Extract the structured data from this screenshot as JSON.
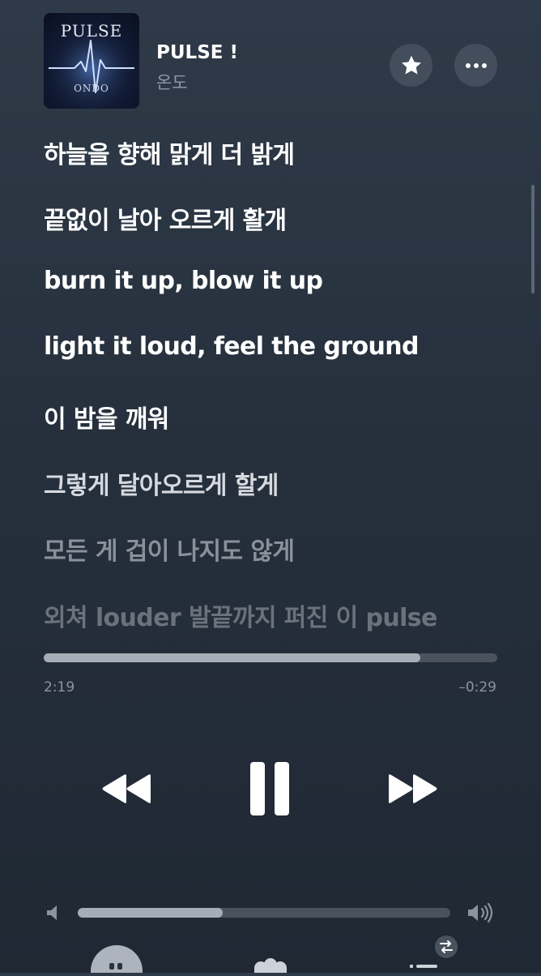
{
  "now_playing": {
    "artwork": {
      "title_text": "PULSE",
      "subtitle_text": "ONDO"
    },
    "title": "PULSE !",
    "artist": "온도",
    "favorite_icon": "star-icon",
    "more_icon": "ellipsis-icon"
  },
  "lyrics": {
    "lines": [
      "하늘을 향해 맑게 더 밝게",
      "끝없이 날아 오르게 활개",
      "burn it up, blow it up",
      "light it loud, feel the ground",
      "이 밤을 깨워",
      "그렇게 달아오르게 할게",
      "모든 게 겁이 나지도 않게",
      "외쳐 louder 발끝까지 퍼진 이 pulse"
    ]
  },
  "playback": {
    "elapsed": "2:19",
    "remaining": "–0:29",
    "progress_fraction": 0.83,
    "is_playing": true
  },
  "controls": {
    "previous_icon": "rewind-icon",
    "pause_icon": "pause-icon",
    "next_icon": "fast-forward-icon"
  },
  "volume": {
    "level_fraction": 0.39,
    "low_icon": "speaker-low-icon",
    "high_icon": "speaker-high-icon"
  },
  "bottom_bar": {
    "icons": [
      "lyrics-quote-icon",
      "airplay-icon",
      "queue-list-icon"
    ]
  },
  "colors": {
    "background_top": "#2f3a48",
    "background_bottom": "#1f2833",
    "primary_text": "#ffffff",
    "secondary_text": "#8e97a6",
    "track": "#4a525e",
    "track_fill": "#a7adb6"
  }
}
